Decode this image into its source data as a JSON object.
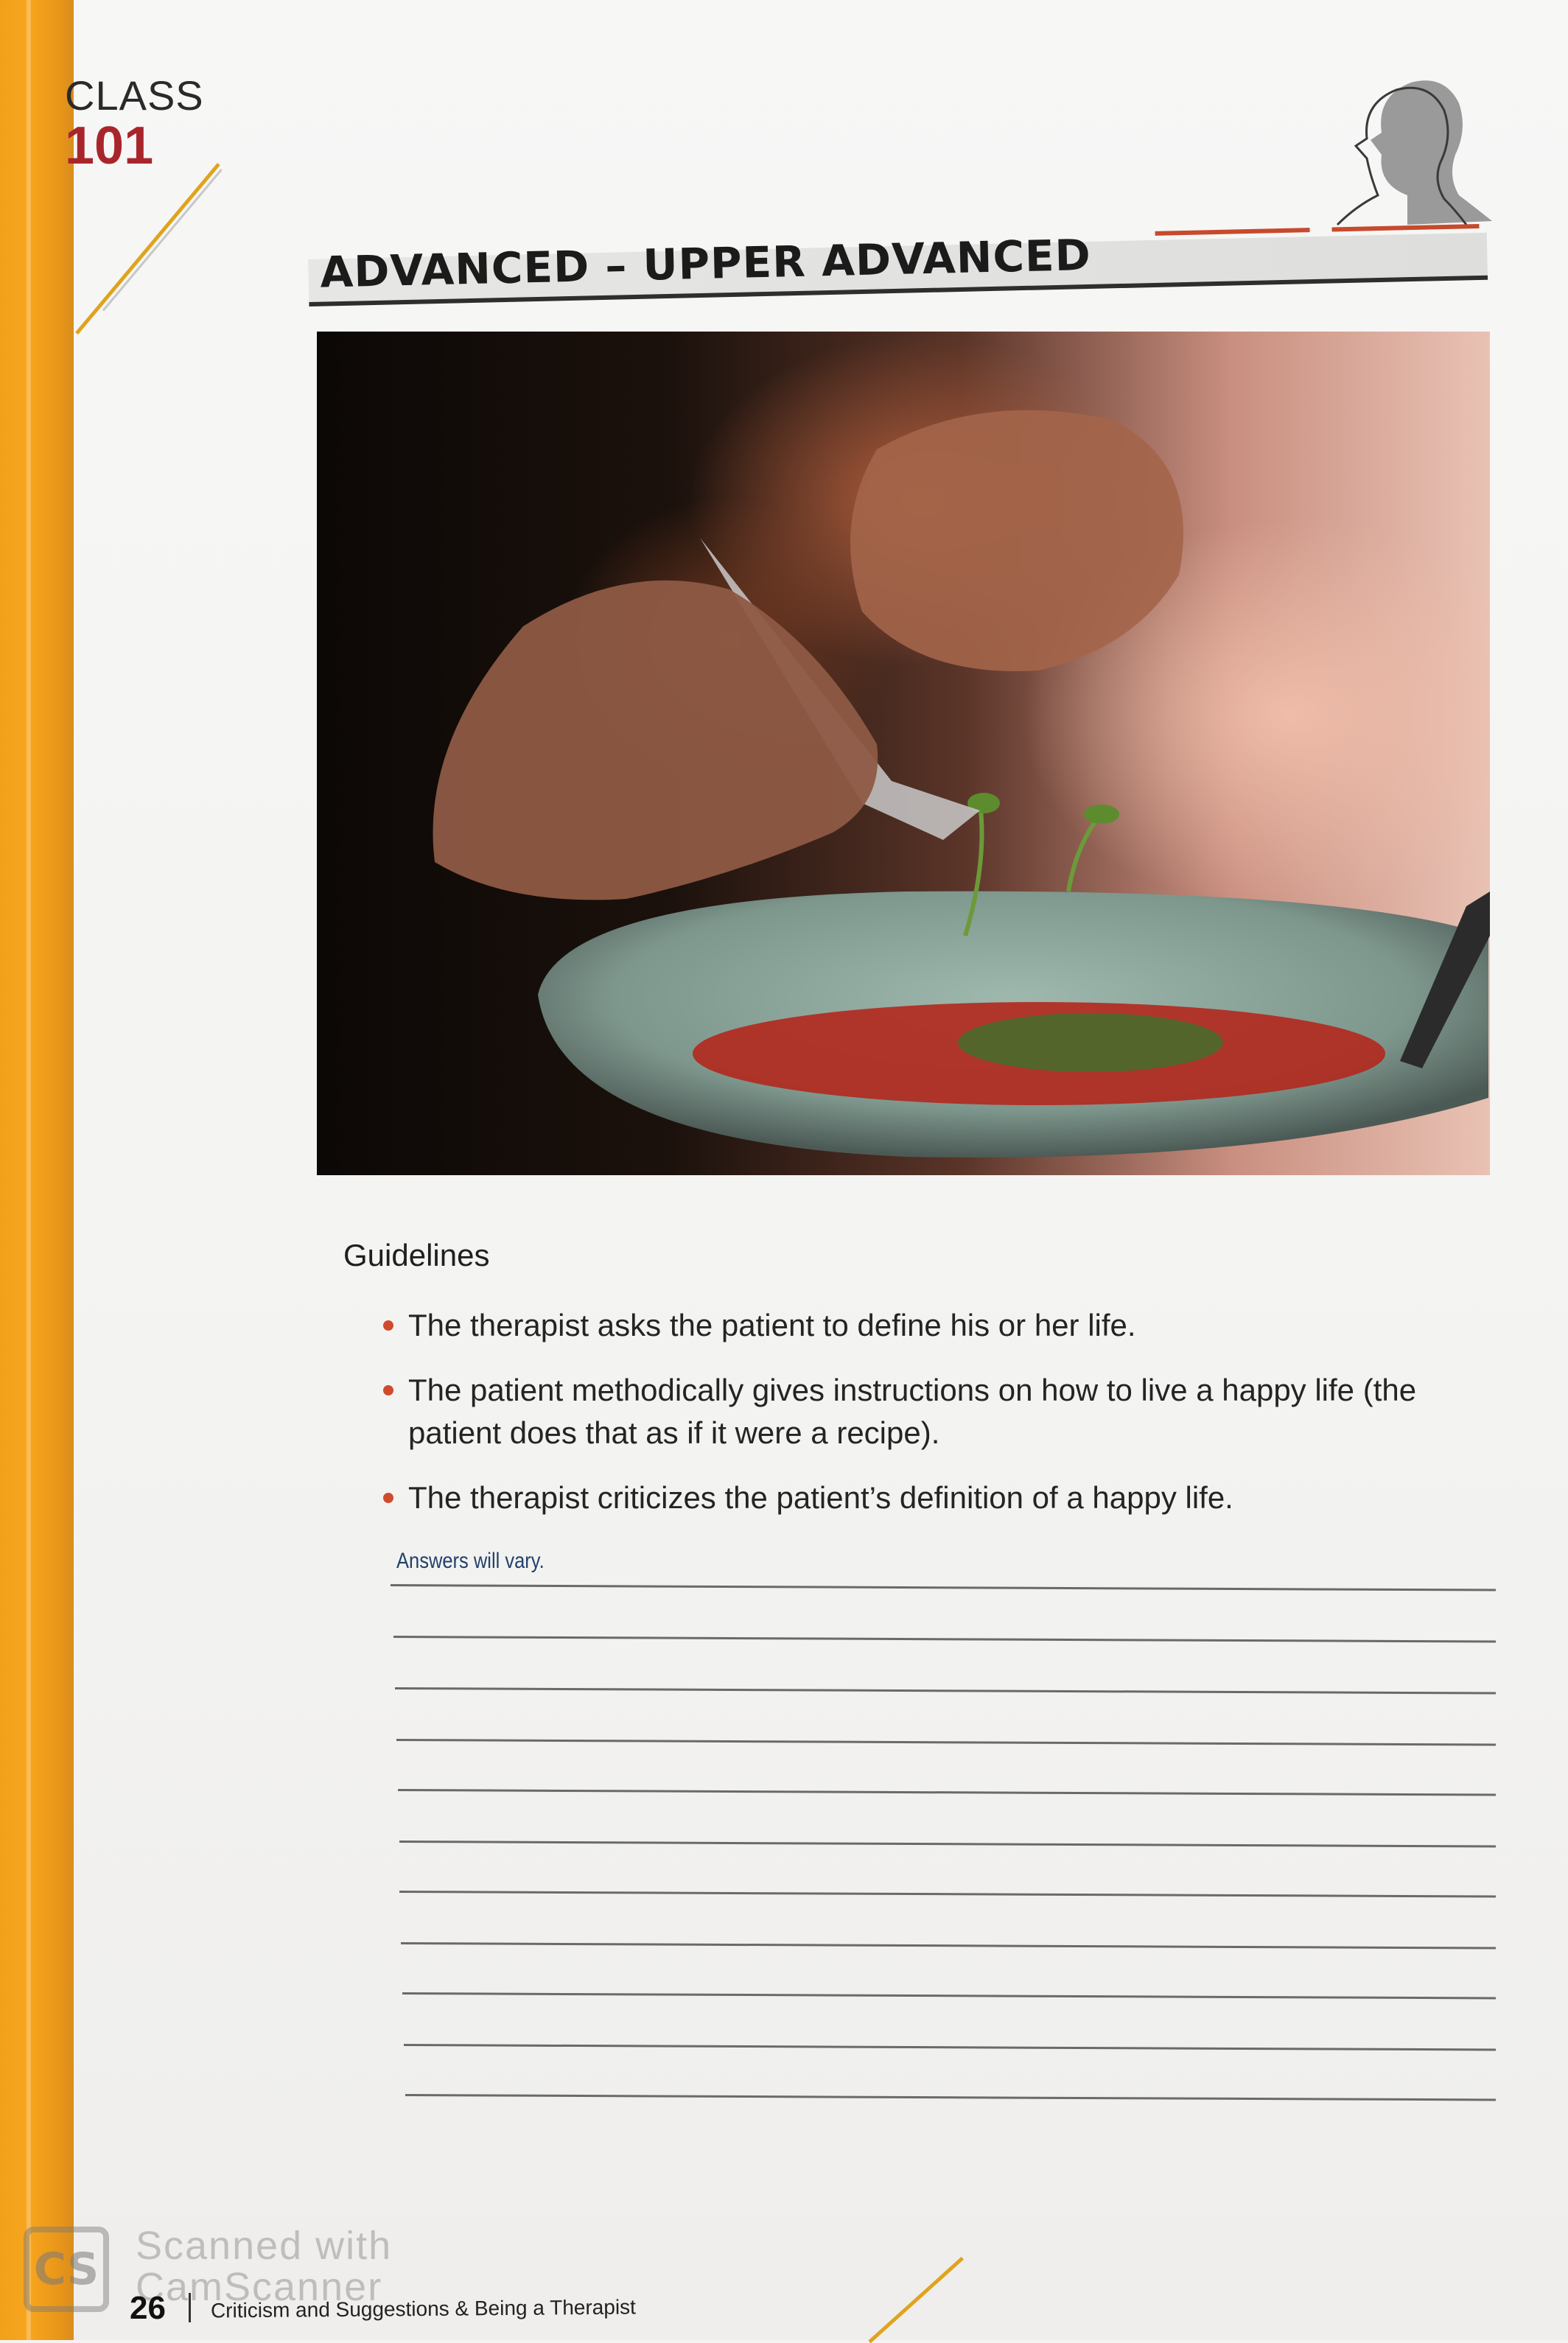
{
  "header": {
    "class_word": "CLASS",
    "class_number": "101",
    "level_title": "ADVANCED – UPPER ADVANCED"
  },
  "photo": {
    "subject": "chef plating a dish with tweezers"
  },
  "guidelines": {
    "title": "Guidelines",
    "items": [
      "The therapist asks the patient to define his or her life.",
      "The patient methodically gives instructions on how to live a happy life (the patient does that as if it were a recipe).",
      "The therapist criticizes the patient’s definition of a happy life."
    ]
  },
  "answer_note": "Answers will vary.",
  "footer": {
    "page_number": "26",
    "chapter_title": "Criticism and Suggestions & Being a Therapist"
  },
  "watermark": {
    "logo": "CS",
    "text_line1": "Scanned with",
    "text_line2": "CamScanner"
  },
  "colors": {
    "page_edge": "#f4a11c",
    "class_number": "#a8262b",
    "bullet": "#cf4b2e",
    "answer_note": "#23406b"
  }
}
